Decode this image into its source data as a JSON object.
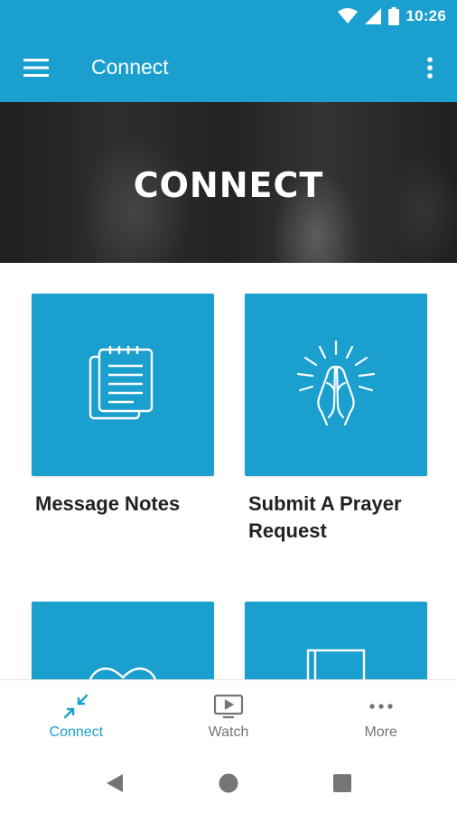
{
  "status_bar": {
    "time": "10:26"
  },
  "app_bar": {
    "title": "Connect"
  },
  "hero": {
    "title": "CONNECT"
  },
  "cards": [
    {
      "label": "Message Notes",
      "icon": "notes-icon"
    },
    {
      "label": "Submit A Prayer Request",
      "icon": "praying-hands-icon"
    },
    {
      "label": "",
      "icon": "heart-icon"
    },
    {
      "label": "",
      "icon": "door-icon"
    }
  ],
  "bottom_nav": [
    {
      "label": "Connect",
      "icon": "connect-arrows-icon",
      "active": true
    },
    {
      "label": "Watch",
      "icon": "watch-tv-icon",
      "active": false
    },
    {
      "label": "More",
      "icon": "more-dots-icon",
      "active": false
    }
  ],
  "colors": {
    "primary": "#1a9fcf",
    "inactive": "#757575"
  }
}
